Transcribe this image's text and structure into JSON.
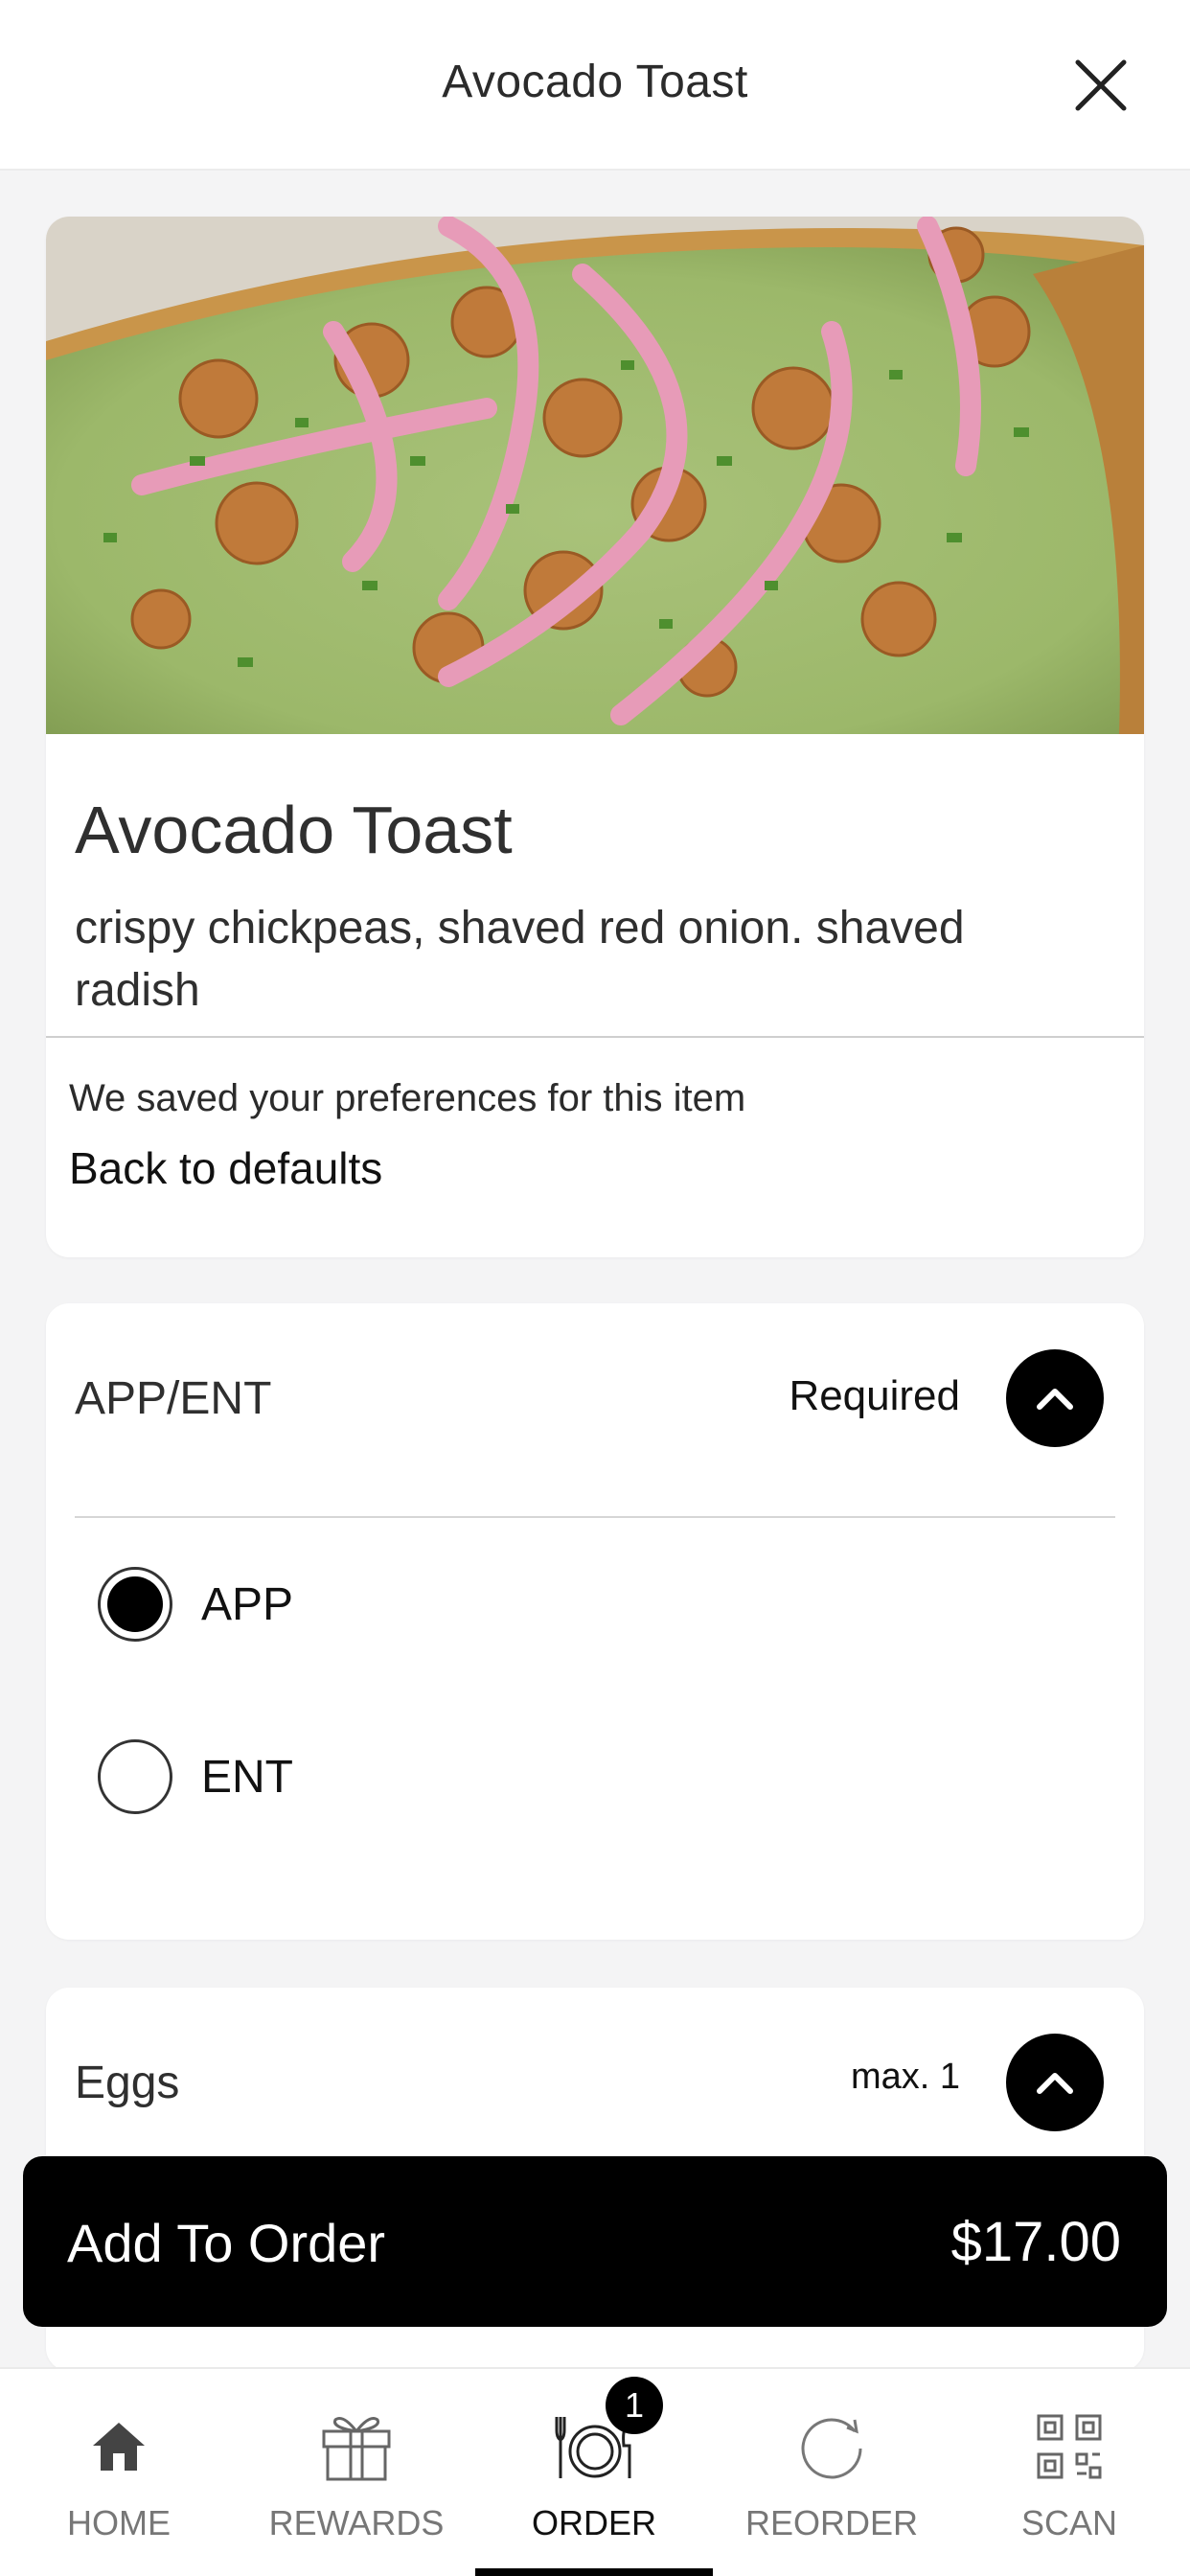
{
  "header": {
    "title": "Avocado Toast"
  },
  "item": {
    "title": "Avocado Toast",
    "description": "crispy chickpeas, shaved red onion. shaved radish",
    "saved_message": "We saved your preferences for this item",
    "defaults_link": "Back to defaults"
  },
  "app_ent": {
    "label": "APP/ENT",
    "required": "Required",
    "options": [
      {
        "label": "APP",
        "selected": true
      },
      {
        "label": "ENT",
        "selected": false
      }
    ]
  },
  "eggs": {
    "label": "Eggs",
    "max": "max. 1"
  },
  "add_to_order": {
    "label": "Add To Order",
    "price": "$17.00"
  },
  "nav": {
    "items": [
      {
        "label": "HOME",
        "icon": "home-icon"
      },
      {
        "label": "REWARDS",
        "icon": "gift-icon"
      },
      {
        "label": "ORDER",
        "icon": "plate-icon",
        "active": true
      },
      {
        "label": "REORDER",
        "icon": "reorder-icon"
      },
      {
        "label": "SCAN",
        "icon": "qr-code-icon"
      }
    ],
    "order_badge": "1"
  },
  "colors": {
    "accent": "#000000",
    "background": "#f4f4f5",
    "card": "#ffffff"
  }
}
